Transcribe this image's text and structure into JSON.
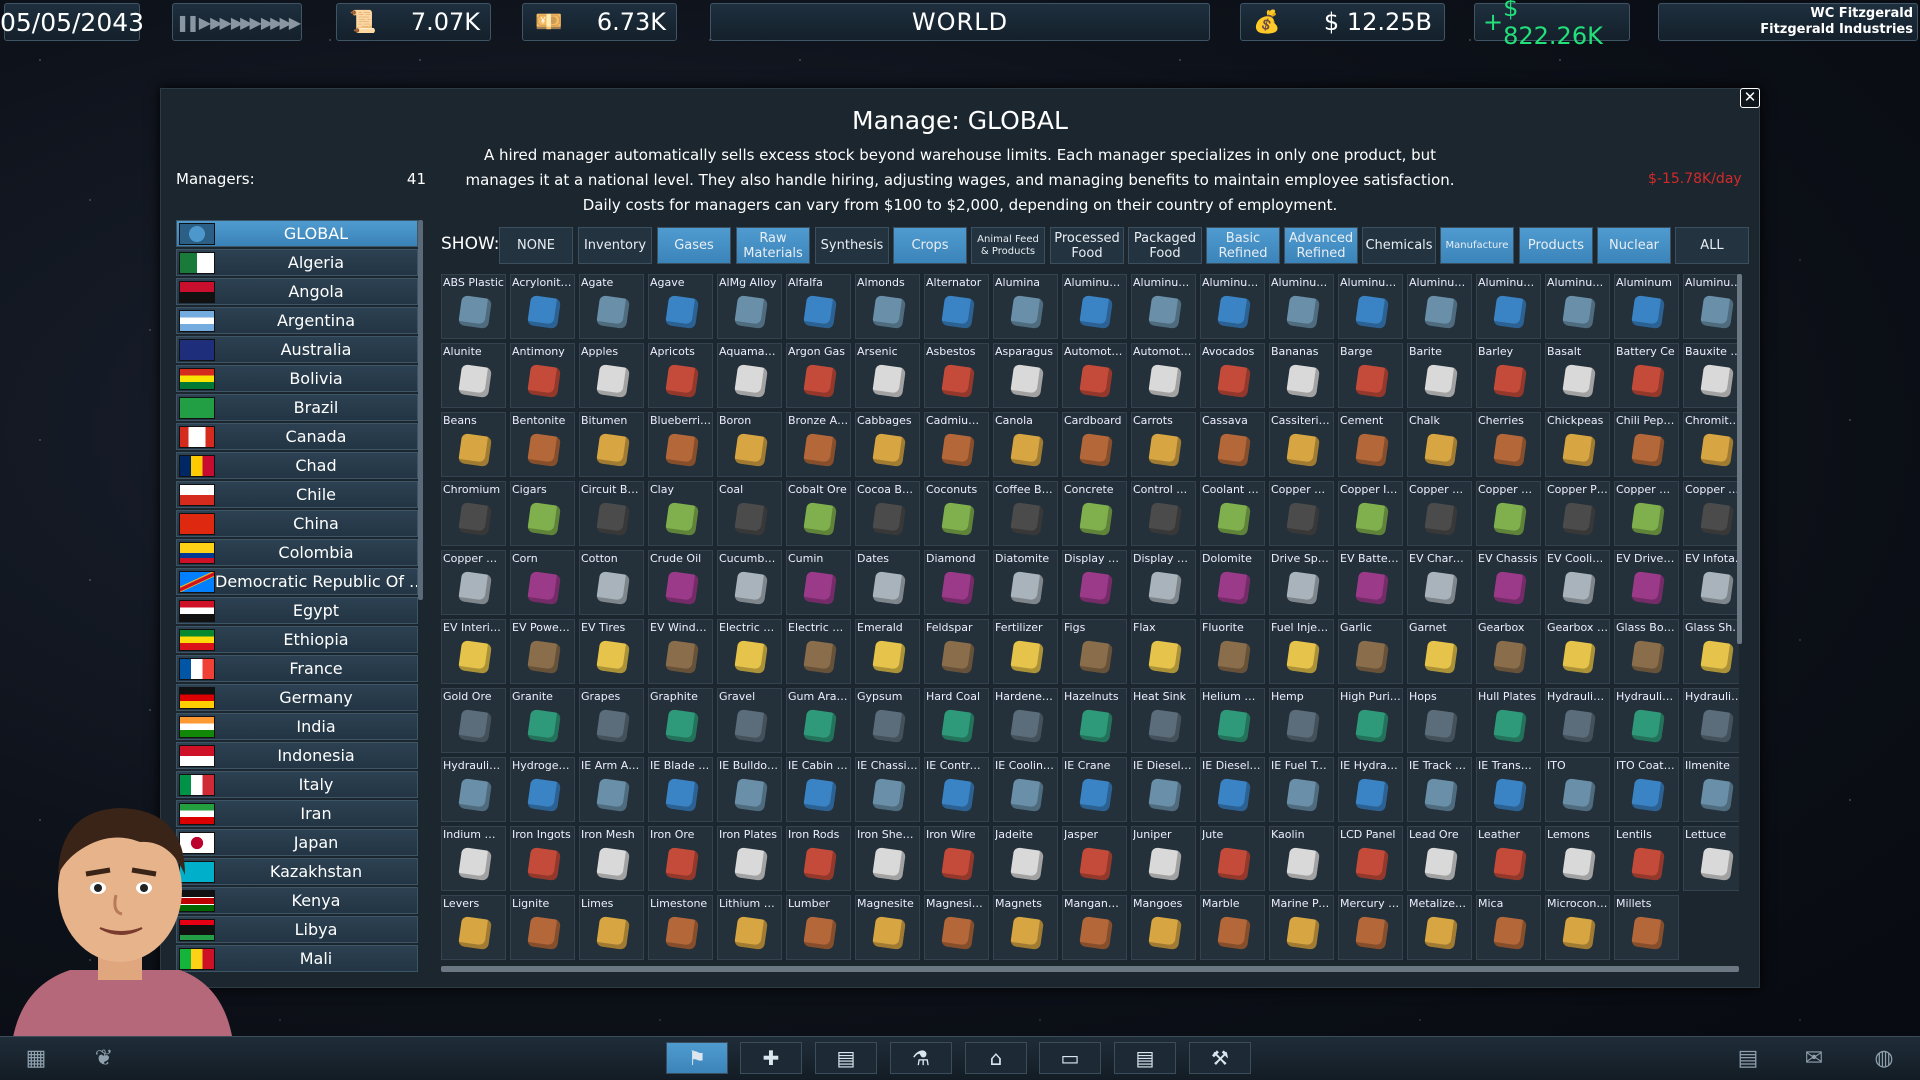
{
  "topbar": {
    "date": "05/05/2043",
    "speed_icons": "❚❚ ▶ ▶▶ ▶▶▶ ▶▶▶▶",
    "res1": "7.07K",
    "res2": "6.73K",
    "world": "WORLD",
    "money": "$ 12.25B",
    "income_sign": "+",
    "income": "$ 822.26K",
    "user": "WC Fitzgerald",
    "company": "Fitzgerald Industries"
  },
  "dialog": {
    "close": "✕",
    "title": "Manage: GLOBAL",
    "desc": "A hired manager automatically sells excess stock beyond warehouse limits. Each manager specializes in only one product, but manages it at a national level. They also handle hiring, adjusting wages, and managing benefits to maintain employee satisfaction. Daily costs for managers can vary from $100 to $2,000, depending on their country of employment.",
    "managers_label": "Managers:",
    "managers_count": "41",
    "cost": "$-15.78K/day",
    "show_label": "SHOW:"
  },
  "colors": {
    "accent": "#4c97cc",
    "income": "#22e07a",
    "cost": "#d32a2a"
  },
  "countries": [
    {
      "name": "GLOBAL",
      "flag": "globe",
      "selected": true
    },
    {
      "name": "Algeria"
    },
    {
      "name": "Angola"
    },
    {
      "name": "Argentina"
    },
    {
      "name": "Australia"
    },
    {
      "name": "Bolivia"
    },
    {
      "name": "Brazil"
    },
    {
      "name": "Canada"
    },
    {
      "name": "Chad"
    },
    {
      "name": "Chile"
    },
    {
      "name": "China"
    },
    {
      "name": "Colombia"
    },
    {
      "name": "Democratic Republic Of ..."
    },
    {
      "name": "Egypt"
    },
    {
      "name": "Ethiopia"
    },
    {
      "name": "France"
    },
    {
      "name": "Germany"
    },
    {
      "name": "India"
    },
    {
      "name": "Indonesia"
    },
    {
      "name": "Italy"
    },
    {
      "name": "Iran"
    },
    {
      "name": "Japan"
    },
    {
      "name": "Kazakhstan"
    },
    {
      "name": "Kenya"
    },
    {
      "name": "Libya"
    },
    {
      "name": "Mali"
    }
  ],
  "filters": [
    {
      "label": "NONE",
      "on": false
    },
    {
      "label": "Inventory",
      "on": false
    },
    {
      "label": "Gases",
      "on": true
    },
    {
      "label": "Raw Materials",
      "on": true
    },
    {
      "label": "Synthesis",
      "on": false
    },
    {
      "label": "Crops",
      "on": true
    },
    {
      "label": "Animal Feed & Products",
      "on": false,
      "small": true
    },
    {
      "label": "Processed Food",
      "on": false
    },
    {
      "label": "Packaged Food",
      "on": false
    },
    {
      "label": "Basic Refined",
      "on": true
    },
    {
      "label": "Advanced Refined",
      "on": true
    },
    {
      "label": "Chemicals",
      "on": false
    },
    {
      "label": "Manufacture",
      "on": true,
      "small": true
    },
    {
      "label": "Products",
      "on": true
    },
    {
      "label": "Nuclear",
      "on": true
    },
    {
      "label": "ALL",
      "on": false
    }
  ],
  "items": [
    "ABS Plastic",
    "Acrylonitrile",
    "Agate",
    "Agave",
    "AlMg Alloy",
    "Alfalfa",
    "Almonds",
    "Alternator",
    "Alumina",
    "Aluminum ...",
    "Aluminum ...",
    "Aluminum ...",
    "Aluminum I...",
    "Aluminum I...",
    "Aluminum ...",
    "Aluminum ...",
    "Aluminum ...",
    "Aluminum",
    "Aluminum ...",
    "Alunite",
    "Antimony",
    "Apples",
    "Apricots",
    "Aquamarine",
    "Argon Gas",
    "Arsenic",
    "Asbestos",
    "Asparagus",
    "Automotiv...",
    "Automotiv...",
    "Avocados",
    "Bananas",
    "Barge",
    "Barite",
    "Barley",
    "Basalt",
    "Battery Ce",
    "Bauxite Ore",
    "Beans",
    "Bentonite",
    "Bitumen",
    "Blueberries",
    "Boron",
    "Bronze Alloy",
    "Cabbages",
    "Cadmium ...",
    "Canola",
    "Cardboard",
    "Carrots",
    "Cassava",
    "Cassiterite ...",
    "Cement",
    "Chalk",
    "Cherries",
    "Chickpeas",
    "Chili Peppe",
    "Chromite O...",
    "Chromium",
    "Cigars",
    "Circuit Board",
    "Clay",
    "Coal",
    "Cobalt Ore",
    "Cocoa Beans",
    "Coconuts",
    "Coffee Beans",
    "Concrete",
    "Control Co...",
    "Coolant Pu...",
    "Copper Coil",
    "Copper Ing...",
    "Copper Mesh",
    "Copper Ore",
    "Copper Pla...",
    "Copper Rod",
    "Copper She...",
    "Copper Wire",
    "Corn",
    "Cotton",
    "Crude Oil",
    "Cucumbers",
    "Cumin",
    "Dates",
    "Diamond",
    "Diatomite",
    "Display Scr...",
    "Display Scr...",
    "Dolomite",
    "Drive Sproc...",
    "EV Battery ...",
    "EV Chargin...",
    "EV Chassis",
    "EV Cooling ...",
    "EV Drivetra",
    "EV Infotain...",
    "EV Interior ...",
    "EV Powertr...",
    "EV Tires",
    "EV Windows",
    "Electric Mo...",
    "Electric Veh...",
    "Emerald",
    "Feldspar",
    "Fertilizer",
    "Figs",
    "Flax",
    "Fluorite",
    "Fuel Injector",
    "Garlic",
    "Garnet",
    "Gearbox",
    "Gearbox H...",
    "Glass Bottle",
    "Glass Sheets",
    "Gold Ore",
    "Granite",
    "Grapes",
    "Graphite",
    "Gravel",
    "Gum Arabic",
    "Gypsum",
    "Hard Coal",
    "Hardened ...",
    "Hazelnuts",
    "Heat Sink",
    "Helium Gas",
    "Hemp",
    "High Purity...",
    "Hops",
    "Hull Plates",
    "Hydraulic C...",
    "Hydraulic C",
    "Hydraulic C...",
    "Hydraulic P...",
    "Hydrogen ...",
    "IE Arm Ass...",
    "IE Blade Unit",
    "IE Bulldozer",
    "IE Cabin As...",
    "IE Chassis F...",
    "IE Control E...",
    "IE Cooling S...",
    "IE Crane",
    "IE Diesel En...",
    "IE Diesel G...",
    "IE Fuel Tank",
    "IE Hydrauli...",
    "IE Track As...",
    "IE Transmis...",
    "ITO",
    "ITO Coating",
    "Ilmenite",
    "Indium Ore",
    "Iron Ingots",
    "Iron Mesh",
    "Iron Ore",
    "Iron Plates",
    "Iron Rods",
    "Iron Sheets",
    "Iron Wire",
    "Jadeite",
    "Jasper",
    "Juniper",
    "Jute",
    "Kaolin",
    "LCD Panel",
    "Lead Ore",
    "Leather",
    "Lemons",
    "Lentils",
    "Lettuce",
    "Levers",
    "Lignite",
    "Limes",
    "Limestone",
    "Lithium Ore",
    "Lumber",
    "Magnesite",
    "Magnesium",
    "Magnets",
    "Manganese...",
    "Mangoes",
    "Marble",
    "Marine Paint",
    "Mercury Ore",
    "Metalized P...",
    "Mica",
    "Microcontr...",
    "Millets"
  ],
  "bottom": {
    "buttons": [
      "⚑",
      "✚",
      "▤",
      "⚗",
      "⌂",
      "▭",
      "▤",
      "⚒"
    ],
    "left_icons": [
      "▦",
      "❦"
    ],
    "right_icons": [
      "▤",
      "✉",
      "◍"
    ]
  }
}
